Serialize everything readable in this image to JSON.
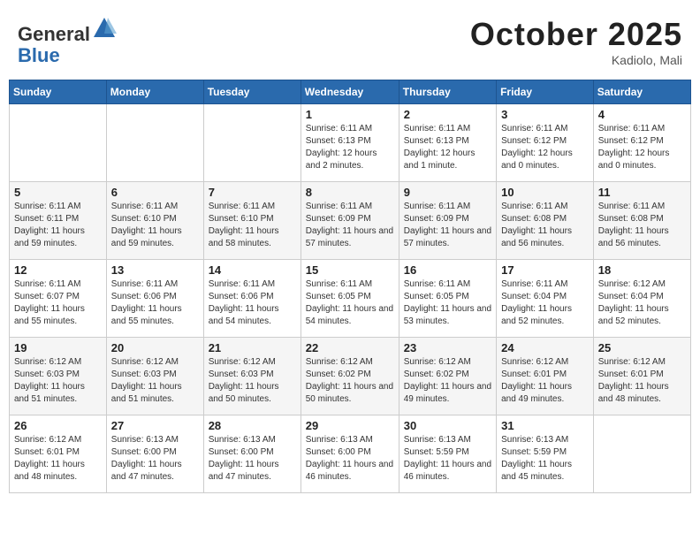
{
  "header": {
    "logo_general": "General",
    "logo_blue": "Blue",
    "month": "October 2025",
    "location": "Kadiolo, Mali"
  },
  "weekdays": [
    "Sunday",
    "Monday",
    "Tuesday",
    "Wednesday",
    "Thursday",
    "Friday",
    "Saturday"
  ],
  "weeks": [
    [
      {
        "day": "",
        "sunrise": "",
        "sunset": "",
        "daylight": ""
      },
      {
        "day": "",
        "sunrise": "",
        "sunset": "",
        "daylight": ""
      },
      {
        "day": "",
        "sunrise": "",
        "sunset": "",
        "daylight": ""
      },
      {
        "day": "1",
        "sunrise": "Sunrise: 6:11 AM",
        "sunset": "Sunset: 6:13 PM",
        "daylight": "Daylight: 12 hours and 2 minutes."
      },
      {
        "day": "2",
        "sunrise": "Sunrise: 6:11 AM",
        "sunset": "Sunset: 6:13 PM",
        "daylight": "Daylight: 12 hours and 1 minute."
      },
      {
        "day": "3",
        "sunrise": "Sunrise: 6:11 AM",
        "sunset": "Sunset: 6:12 PM",
        "daylight": "Daylight: 12 hours and 0 minutes."
      },
      {
        "day": "4",
        "sunrise": "Sunrise: 6:11 AM",
        "sunset": "Sunset: 6:12 PM",
        "daylight": "Daylight: 12 hours and 0 minutes."
      }
    ],
    [
      {
        "day": "5",
        "sunrise": "Sunrise: 6:11 AM",
        "sunset": "Sunset: 6:11 PM",
        "daylight": "Daylight: 11 hours and 59 minutes."
      },
      {
        "day": "6",
        "sunrise": "Sunrise: 6:11 AM",
        "sunset": "Sunset: 6:10 PM",
        "daylight": "Daylight: 11 hours and 59 minutes."
      },
      {
        "day": "7",
        "sunrise": "Sunrise: 6:11 AM",
        "sunset": "Sunset: 6:10 PM",
        "daylight": "Daylight: 11 hours and 58 minutes."
      },
      {
        "day": "8",
        "sunrise": "Sunrise: 6:11 AM",
        "sunset": "Sunset: 6:09 PM",
        "daylight": "Daylight: 11 hours and 57 minutes."
      },
      {
        "day": "9",
        "sunrise": "Sunrise: 6:11 AM",
        "sunset": "Sunset: 6:09 PM",
        "daylight": "Daylight: 11 hours and 57 minutes."
      },
      {
        "day": "10",
        "sunrise": "Sunrise: 6:11 AM",
        "sunset": "Sunset: 6:08 PM",
        "daylight": "Daylight: 11 hours and 56 minutes."
      },
      {
        "day": "11",
        "sunrise": "Sunrise: 6:11 AM",
        "sunset": "Sunset: 6:08 PM",
        "daylight": "Daylight: 11 hours and 56 minutes."
      }
    ],
    [
      {
        "day": "12",
        "sunrise": "Sunrise: 6:11 AM",
        "sunset": "Sunset: 6:07 PM",
        "daylight": "Daylight: 11 hours and 55 minutes."
      },
      {
        "day": "13",
        "sunrise": "Sunrise: 6:11 AM",
        "sunset": "Sunset: 6:06 PM",
        "daylight": "Daylight: 11 hours and 55 minutes."
      },
      {
        "day": "14",
        "sunrise": "Sunrise: 6:11 AM",
        "sunset": "Sunset: 6:06 PM",
        "daylight": "Daylight: 11 hours and 54 minutes."
      },
      {
        "day": "15",
        "sunrise": "Sunrise: 6:11 AM",
        "sunset": "Sunset: 6:05 PM",
        "daylight": "Daylight: 11 hours and 54 minutes."
      },
      {
        "day": "16",
        "sunrise": "Sunrise: 6:11 AM",
        "sunset": "Sunset: 6:05 PM",
        "daylight": "Daylight: 11 hours and 53 minutes."
      },
      {
        "day": "17",
        "sunrise": "Sunrise: 6:11 AM",
        "sunset": "Sunset: 6:04 PM",
        "daylight": "Daylight: 11 hours and 52 minutes."
      },
      {
        "day": "18",
        "sunrise": "Sunrise: 6:12 AM",
        "sunset": "Sunset: 6:04 PM",
        "daylight": "Daylight: 11 hours and 52 minutes."
      }
    ],
    [
      {
        "day": "19",
        "sunrise": "Sunrise: 6:12 AM",
        "sunset": "Sunset: 6:03 PM",
        "daylight": "Daylight: 11 hours and 51 minutes."
      },
      {
        "day": "20",
        "sunrise": "Sunrise: 6:12 AM",
        "sunset": "Sunset: 6:03 PM",
        "daylight": "Daylight: 11 hours and 51 minutes."
      },
      {
        "day": "21",
        "sunrise": "Sunrise: 6:12 AM",
        "sunset": "Sunset: 6:03 PM",
        "daylight": "Daylight: 11 hours and 50 minutes."
      },
      {
        "day": "22",
        "sunrise": "Sunrise: 6:12 AM",
        "sunset": "Sunset: 6:02 PM",
        "daylight": "Daylight: 11 hours and 50 minutes."
      },
      {
        "day": "23",
        "sunrise": "Sunrise: 6:12 AM",
        "sunset": "Sunset: 6:02 PM",
        "daylight": "Daylight: 11 hours and 49 minutes."
      },
      {
        "day": "24",
        "sunrise": "Sunrise: 6:12 AM",
        "sunset": "Sunset: 6:01 PM",
        "daylight": "Daylight: 11 hours and 49 minutes."
      },
      {
        "day": "25",
        "sunrise": "Sunrise: 6:12 AM",
        "sunset": "Sunset: 6:01 PM",
        "daylight": "Daylight: 11 hours and 48 minutes."
      }
    ],
    [
      {
        "day": "26",
        "sunrise": "Sunrise: 6:12 AM",
        "sunset": "Sunset: 6:01 PM",
        "daylight": "Daylight: 11 hours and 48 minutes."
      },
      {
        "day": "27",
        "sunrise": "Sunrise: 6:13 AM",
        "sunset": "Sunset: 6:00 PM",
        "daylight": "Daylight: 11 hours and 47 minutes."
      },
      {
        "day": "28",
        "sunrise": "Sunrise: 6:13 AM",
        "sunset": "Sunset: 6:00 PM",
        "daylight": "Daylight: 11 hours and 47 minutes."
      },
      {
        "day": "29",
        "sunrise": "Sunrise: 6:13 AM",
        "sunset": "Sunset: 6:00 PM",
        "daylight": "Daylight: 11 hours and 46 minutes."
      },
      {
        "day": "30",
        "sunrise": "Sunrise: 6:13 AM",
        "sunset": "Sunset: 5:59 PM",
        "daylight": "Daylight: 11 hours and 46 minutes."
      },
      {
        "day": "31",
        "sunrise": "Sunrise: 6:13 AM",
        "sunset": "Sunset: 5:59 PM",
        "daylight": "Daylight: 11 hours and 45 minutes."
      },
      {
        "day": "",
        "sunrise": "",
        "sunset": "",
        "daylight": ""
      }
    ]
  ]
}
